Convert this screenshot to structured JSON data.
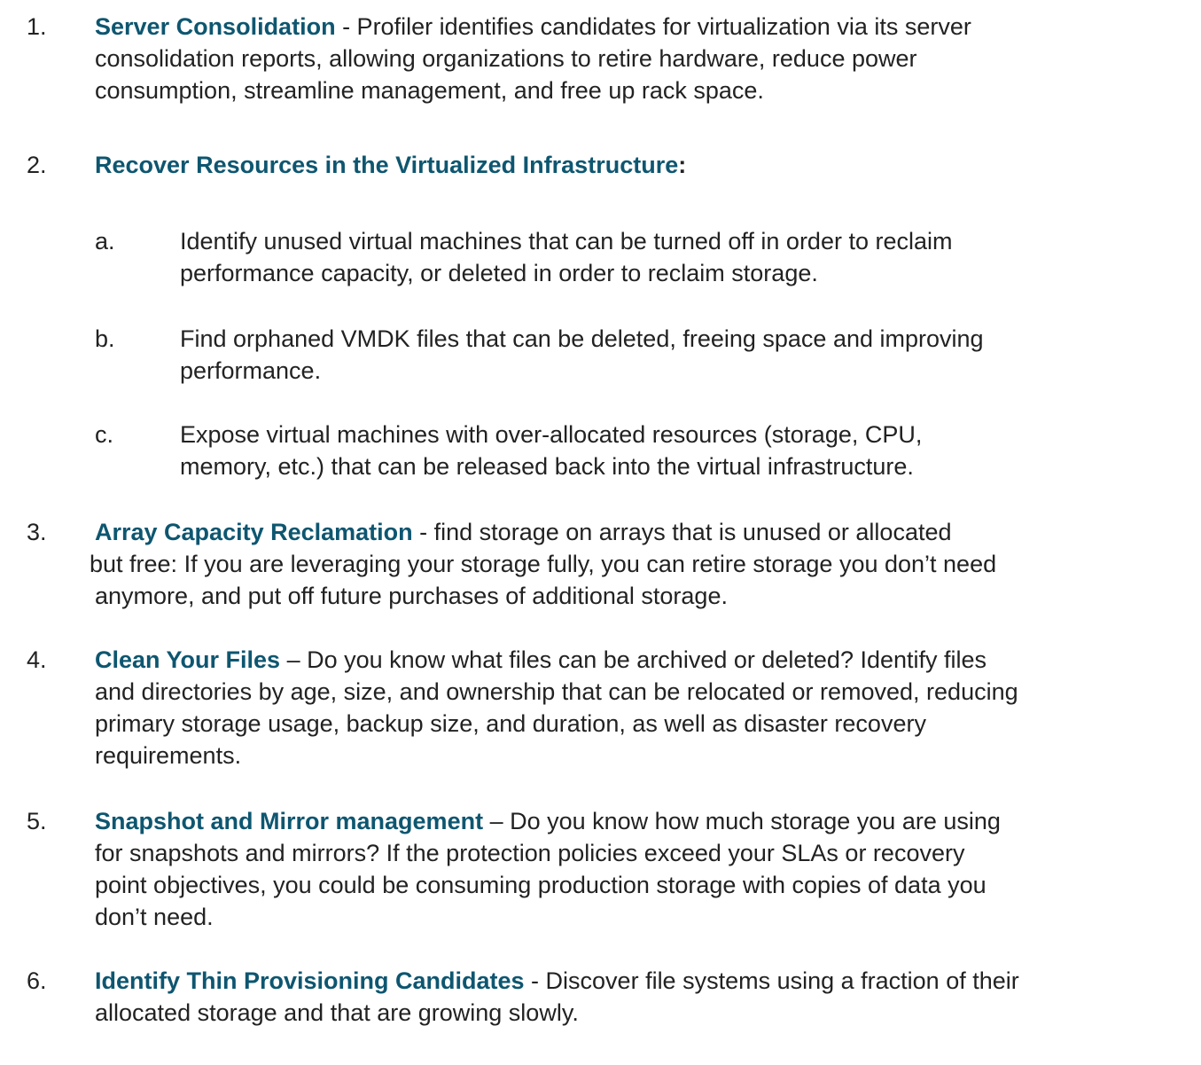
{
  "items": [
    {
      "number": "1.",
      "title": "Server Consolidation",
      "lines": [
        " - Profiler identifies candidates for virtualization via its server",
        "consolidation reports, allowing organizations to retire hardware, reduce power",
        "consumption, streamline management, and free up rack space."
      ]
    },
    {
      "number": "2.",
      "title": "Recover Resources in the Virtualized Infrastructure",
      "title_suffix": ":",
      "subitems": [
        {
          "letter": "a.",
          "lines": [
            "Identify unused virtual machines that can be turned off in order to reclaim",
            "performance capacity, or deleted in order to reclaim storage."
          ]
        },
        {
          "letter": "b.",
          "lines": [
            "Find orphaned VMDK files that can be deleted, freeing space and improving",
            "performance."
          ]
        },
        {
          "letter": "c.",
          "lines": [
            "Expose virtual machines with over-allocated resources (storage, CPU,",
            "memory, etc.) that can be released back into the virtual infrastructure."
          ]
        }
      ]
    },
    {
      "number": "3.",
      "title": "Array Capacity Reclamation",
      "lines": [
        " - find storage on arrays that is unused or allocated",
        "but free:  If you are leveraging your storage fully, you can retire storage you don’t need",
        "anymore, and put off future purchases of additional storage."
      ]
    },
    {
      "number": "4.",
      "title": "Clean Your Files",
      "lines": [
        " – Do you know what files can be archived or deleted?  Identify files",
        "and directories by age, size, and ownership that can be relocated or removed, reducing",
        "primary storage usage, backup size, and duration, as well as disaster recovery",
        "requirements."
      ]
    },
    {
      "number": "5.",
      "title": "Snapshot and Mirror management",
      "lines": [
        " – Do you know how much storage you are using",
        "for snapshots and mirrors?  If the protection policies exceed your SLAs or recovery",
        "point objectives, you could be consuming production storage with copies of data you",
        "don’t need."
      ]
    },
    {
      "number": "6.",
      "title": "Identify Thin Provisioning Candidates",
      "lines": [
        " - Discover file systems using a fraction of their",
        "allocated storage and that are growing slowly."
      ]
    }
  ]
}
